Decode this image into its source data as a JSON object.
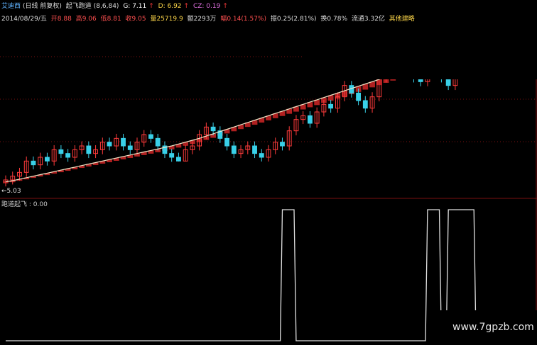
{
  "header": {
    "stock_name": "艾迪西",
    "period_info": "(日线 前复权)",
    "indicator_name": "起飞跑道",
    "params": "(8,6,84)",
    "g_label": "G: 7.11",
    "d_label": "D: 6.92",
    "cz_label": "CZ: 0.19"
  },
  "info": {
    "date": "2014/08/29/五",
    "open": "开8.88",
    "high": "高9.06",
    "low": "低8.81",
    "close": "收9.05",
    "volume": "量25719.9",
    "amount": "额2293万",
    "change": "幅0.14(1.57%)",
    "amplitude": "振0.25(2.81%)",
    "turnover": "换0.78%",
    "float": "流通3.32亿",
    "extra": "其他建略"
  },
  "price_low_label": "←5.03",
  "indicator_panel": {
    "label": "跑道起飞 : 0.00"
  },
  "watermark": "www.7gpzb.com",
  "colors": {
    "up": "#ff3b3b",
    "down": "#39d0e8",
    "ma": "#f2e6c8",
    "band": "#b02020",
    "signal": "#e0e0e0",
    "grid": "#7a1010"
  },
  "chart_data": [
    {
      "type": "candlestick",
      "title": "艾迪西 起飞跑道",
      "ylim": [
        4.8,
        9.3
      ],
      "series": [
        {
          "name": "price",
          "values": [
            5.1,
            5.2,
            5.3,
            5.6,
            5.5,
            5.7,
            5.6,
            5.9,
            5.8,
            5.7,
            5.9,
            6.0,
            5.8,
            5.9,
            6.1,
            6.0,
            6.2,
            6.0,
            5.9,
            6.1,
            6.3,
            6.2,
            6.0,
            5.8,
            5.7,
            5.6,
            5.9,
            6.0,
            6.3,
            6.5,
            6.4,
            6.2,
            6.0,
            5.8,
            5.9,
            6.0,
            5.8,
            5.7,
            5.9,
            6.1,
            6.0,
            6.4,
            6.7,
            6.8,
            6.6,
            6.9,
            7.1,
            7.0,
            7.3,
            7.6,
            7.4,
            7.2,
            7.0,
            7.3,
            7.8,
            8.2,
            8.5,
            8.3,
            8.0,
            7.8,
            7.7,
            7.9,
            8.1,
            7.8,
            7.6,
            7.9,
            8.2,
            8.4,
            8.2,
            8.3,
            8.6,
            8.5,
            8.8,
            9.0,
            8.9,
            8.7,
            9.05
          ]
        },
        {
          "name": "MA",
          "values": [
            5.05,
            5.08,
            5.12,
            5.16,
            5.2,
            5.24,
            5.28,
            5.32,
            5.36,
            5.4,
            5.44,
            5.48,
            5.52,
            5.56,
            5.6,
            5.64,
            5.68,
            5.72,
            5.76,
            5.8,
            5.84,
            5.88,
            5.92,
            5.96,
            6.0,
            6.05,
            6.1,
            6.15,
            6.2,
            6.26,
            6.32,
            6.38,
            6.44,
            6.5,
            6.56,
            6.62,
            6.68,
            6.74,
            6.8,
            6.86,
            6.92,
            6.98,
            7.04,
            7.1,
            7.16,
            7.22,
            7.28,
            7.34,
            7.4,
            7.46,
            7.52,
            7.58,
            7.64,
            7.7,
            7.76,
            7.82,
            7.88,
            7.94,
            8.0,
            8.05,
            8.1,
            8.15,
            8.2,
            8.25,
            8.3,
            8.35,
            8.4,
            8.45,
            8.5,
            8.55,
            8.6,
            8.65,
            8.7,
            8.75,
            8.8,
            8.85,
            8.9
          ]
        }
      ]
    },
    {
      "type": "line",
      "title": "跑道起飞",
      "ylim": [
        0,
        1
      ],
      "series": [
        {
          "name": "跑道起飞",
          "values": [
            0,
            0,
            0,
            0,
            0,
            0,
            0,
            0,
            0,
            0,
            0,
            0,
            0,
            0,
            0,
            0,
            0,
            0,
            0,
            0,
            0,
            0,
            0,
            0,
            0,
            0,
            0,
            0,
            0,
            0,
            0,
            0,
            0,
            0,
            0,
            0,
            0,
            0,
            0,
            0,
            1,
            1,
            0,
            0,
            0,
            0,
            0,
            0,
            0,
            0,
            0,
            0,
            0,
            0,
            0,
            0,
            0,
            0,
            0,
            0,
            0,
            1,
            1,
            0,
            1,
            1,
            1,
            1,
            0,
            0,
            0,
            0,
            0,
            0,
            0,
            0,
            0
          ]
        }
      ]
    }
  ]
}
